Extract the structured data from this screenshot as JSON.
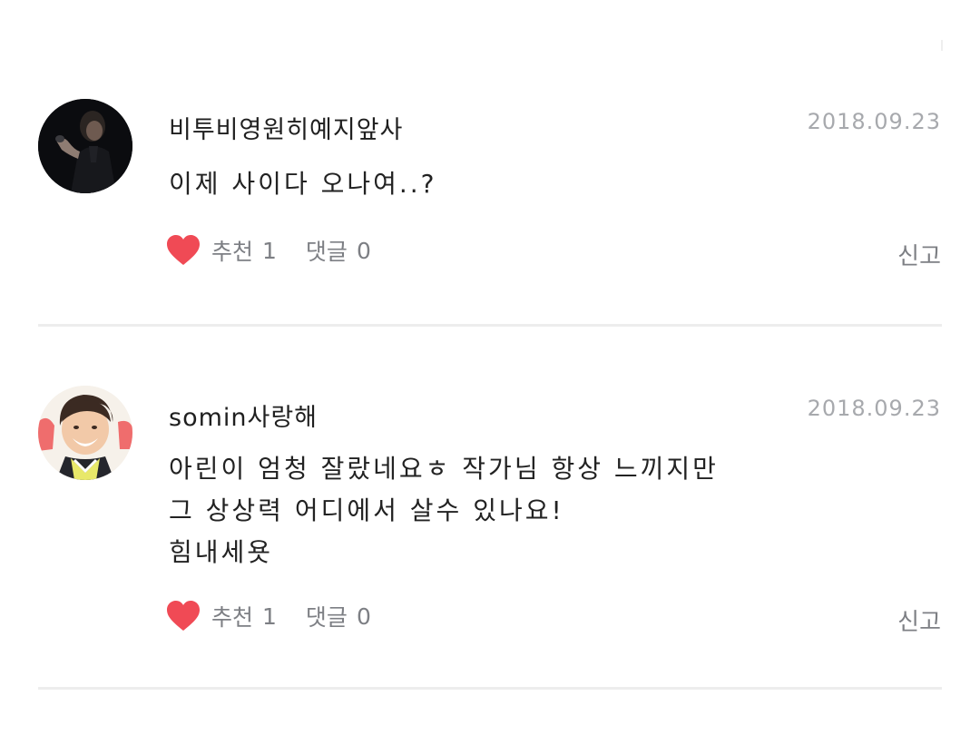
{
  "comments": [
    {
      "username": "비투비영원히예지앞사",
      "date": "2018.09.23",
      "body_lines": [
        "이제 사이다 오나여..?"
      ],
      "like_label": "추천",
      "like_count": "1",
      "reply_label": "댓글",
      "reply_count": "0",
      "report_label": "신고",
      "avatar_icon": "user-avatar-icon",
      "heart_icon": "heart-icon",
      "heart_color": "#f04a55"
    },
    {
      "username": "somin사랑해",
      "date": "2018.09.23",
      "body_lines": [
        "아린이 엄청 잘랐네요ㅎ 작가님 항상 느끼지만",
        "그 상상력 어디에서 살수 있나요!",
        "힘내세욧"
      ],
      "like_label": "추천",
      "like_count": "1",
      "reply_label": "댓글",
      "reply_count": "0",
      "report_label": "신고",
      "avatar_icon": "user-avatar-icon",
      "heart_icon": "heart-icon",
      "heart_color": "#f04a55"
    }
  ]
}
